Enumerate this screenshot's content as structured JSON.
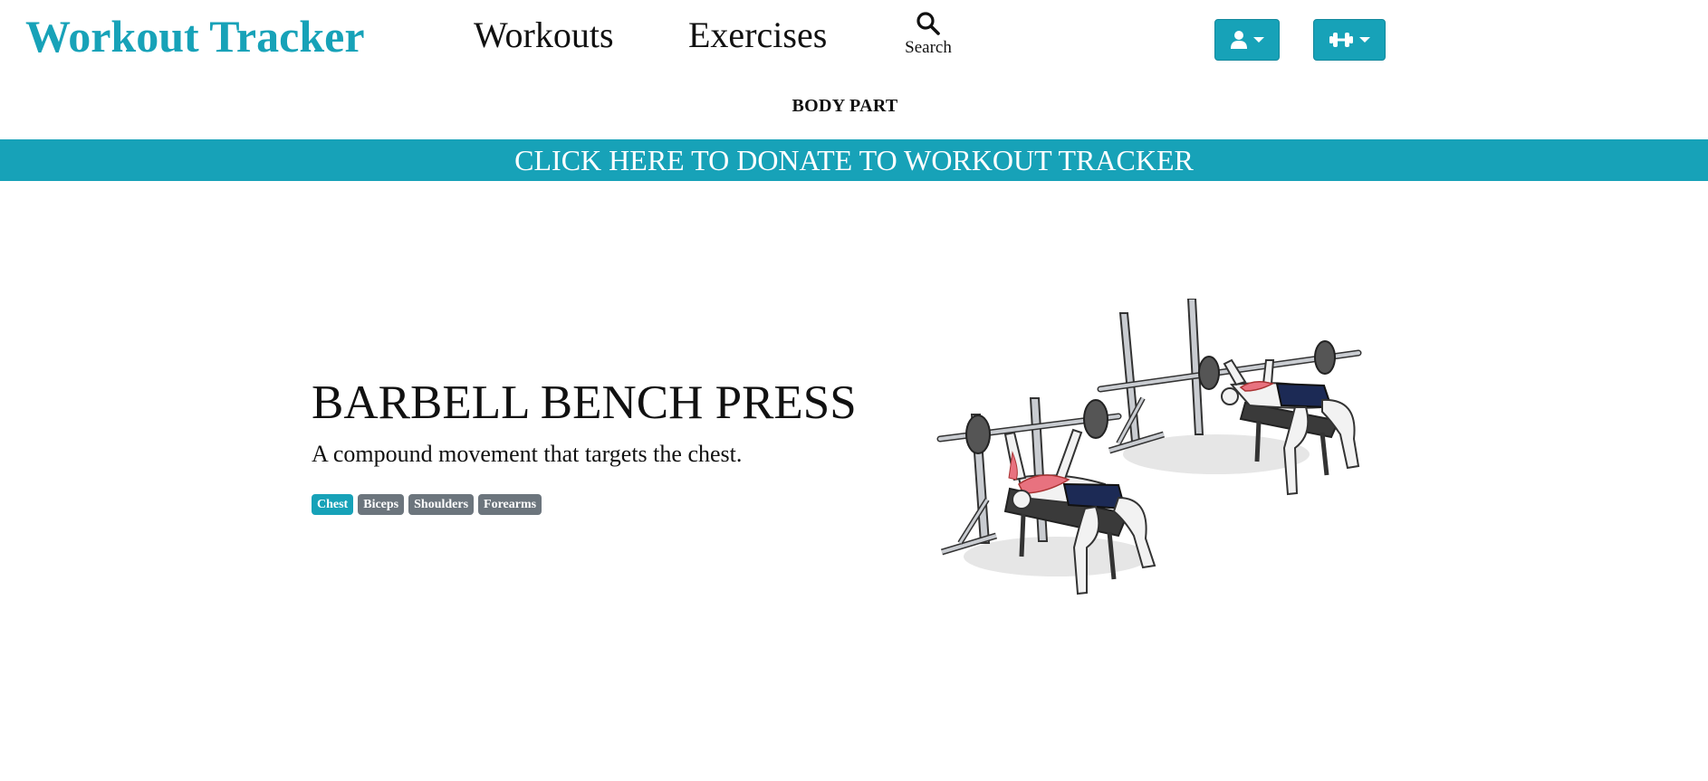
{
  "header": {
    "brand": "Workout Tracker",
    "nav": {
      "workouts": "Workouts",
      "exercises": "Exercises",
      "search": "Search"
    },
    "user_menu_icon": "user-icon",
    "workout_menu_icon": "dumbbell-icon"
  },
  "subnav": {
    "body_part": "BODY PART"
  },
  "banner": {
    "text": "CLICK HERE TO DONATE TO WORKOUT TRACKER"
  },
  "exercise": {
    "title": "BARBELL BENCH PRESS",
    "description": "A compound movement that targets the chest.",
    "tags": [
      {
        "label": "Chest",
        "primary": true
      },
      {
        "label": "Biceps",
        "primary": false
      },
      {
        "label": "Shoulders",
        "primary": false
      },
      {
        "label": "Forearms",
        "primary": false
      }
    ]
  },
  "colors": {
    "accent": "#17a2b8",
    "secondary": "#6c757d",
    "muscle_highlight": "#e8727f",
    "shorts": "#1c2a55"
  }
}
